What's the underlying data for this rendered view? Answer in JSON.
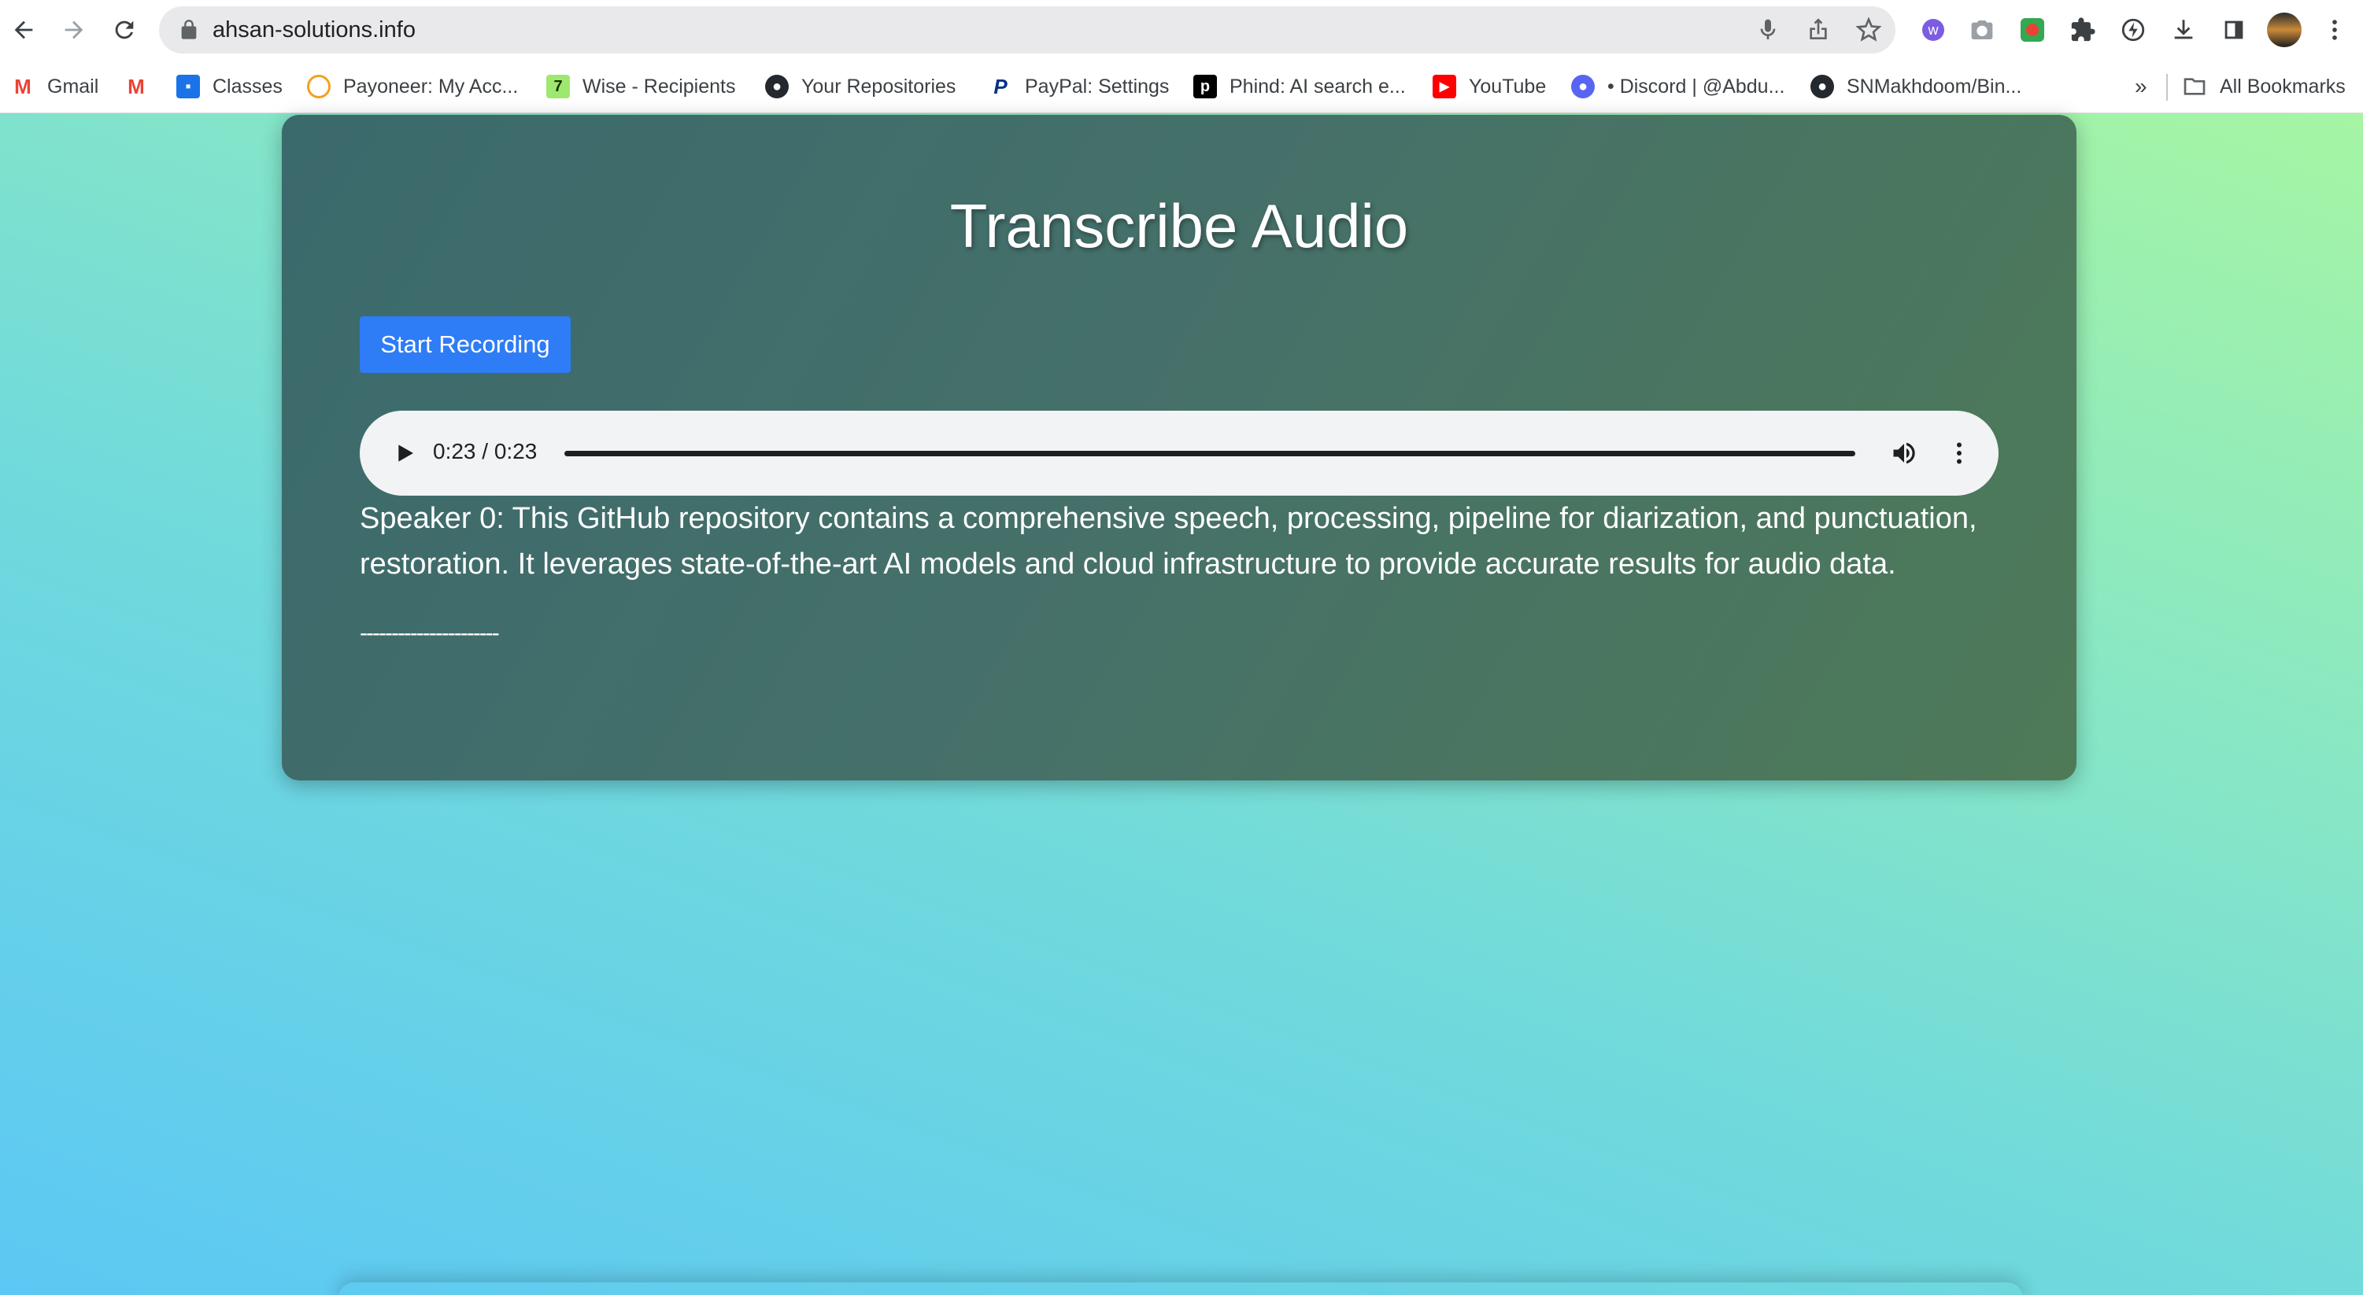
{
  "browser": {
    "url": "ahsan-solutions.info",
    "bookmarks": [
      {
        "label": "Gmail",
        "icon": "gmail-icon",
        "color": "#ea4335"
      },
      {
        "label": "",
        "icon": "gmail-m-icon",
        "color": "#ea4335"
      },
      {
        "label": "Classes",
        "icon": "classroom-icon",
        "color": "#1a73e8"
      },
      {
        "label": "Payoneer: My Acc...",
        "icon": "payoneer-icon",
        "color": "#ff4800"
      },
      {
        "label": "Wise - Recipients",
        "icon": "wise-icon",
        "color": "#9fe870"
      },
      {
        "label": "Your Repositories",
        "icon": "github-icon",
        "color": "#24292f"
      },
      {
        "label": "PayPal: Settings",
        "icon": "paypal-icon",
        "color": "#003087"
      },
      {
        "label": "Phind: AI search e...",
        "icon": "phind-icon",
        "color": "#000000"
      },
      {
        "label": "YouTube",
        "icon": "youtube-icon",
        "color": "#ff0000"
      },
      {
        "label": "• Discord | @Abdu...",
        "icon": "discord-icon",
        "color": "#5865f2"
      },
      {
        "label": "SNMakhdoom/Bin...",
        "icon": "github-icon",
        "color": "#24292f"
      }
    ],
    "overflow_label": "»",
    "all_bookmarks_label": "All Bookmarks"
  },
  "app": {
    "title": "Transcribe Audio",
    "record_button": "Start Recording",
    "audio": {
      "time": "0:23 / 0:23",
      "progress": 1.0
    },
    "transcript": "Speaker 0: This GitHub repository contains a comprehensive speech, processing, pipeline for diarization, and punctuation, restoration. It leverages state-of-the-art AI models and cloud infrastructure to provide accurate results for audio data.",
    "separator": "----------------------"
  }
}
